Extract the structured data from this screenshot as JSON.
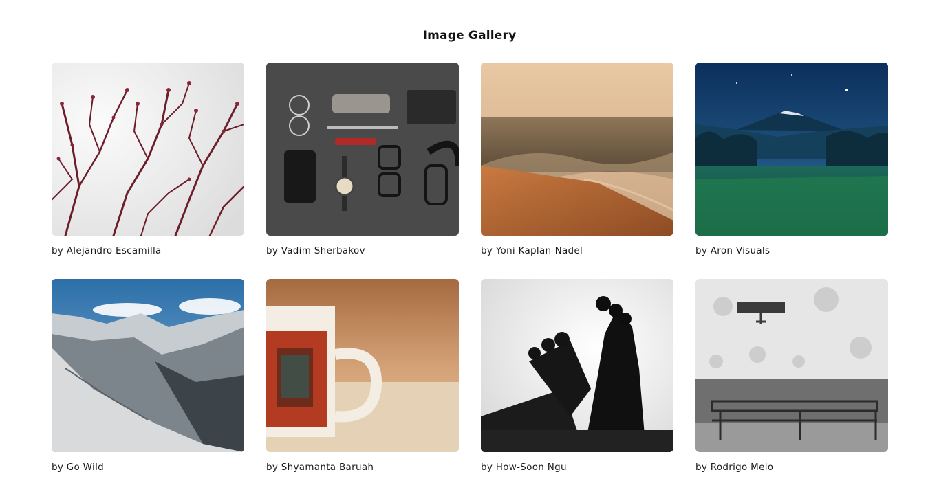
{
  "gallery": {
    "title": "Image Gallery",
    "items": [
      {
        "caption": "by Alejandro Escamilla",
        "subject": "flowering-branches"
      },
      {
        "caption": "by Vadim Sherbakov",
        "subject": "flatlay-accessories"
      },
      {
        "caption": "by Yoni Kaplan-Nadel",
        "subject": "beach-waves"
      },
      {
        "caption": "by Aron Visuals",
        "subject": "night-mountain"
      },
      {
        "caption": "by Go Wild",
        "subject": "snowy-mountains"
      },
      {
        "caption": "by Shyamanta Baruah",
        "subject": "coffee-mug"
      },
      {
        "caption": "by How-Soon Ngu",
        "subject": "bare-feet"
      },
      {
        "caption": "by Rodrigo Melo",
        "subject": "bench-wall"
      }
    ]
  }
}
